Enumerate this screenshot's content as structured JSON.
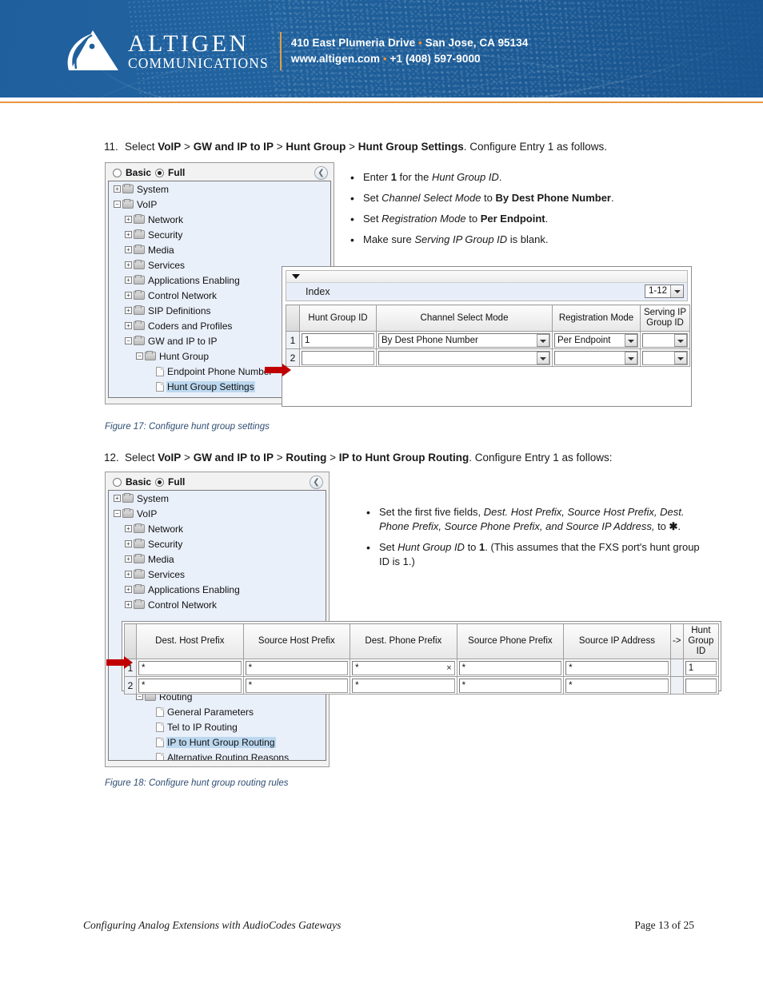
{
  "header": {
    "logo_primary": "ALTIGEN",
    "logo_secondary": "COMMUNICATIONS",
    "address_line1": "410 East Plumeria Drive",
    "address_line2_city": "San Jose, CA 95134",
    "website": "www.altigen.com",
    "phone": "+1 (408) 597-9000",
    "bullet": "•",
    "brand_blue": "#1f6097",
    "accent_orange": "#e8963c"
  },
  "steps": {
    "step11": {
      "number": "11.",
      "pre": "Select ",
      "path1": "VoIP",
      "sep": " > ",
      "path2": "GW and IP to IP",
      "path3": "Hunt Group",
      "path4": "Hunt Group Settings",
      "post": ".  Configure Entry 1 as follows."
    },
    "step12": {
      "number": "12.",
      "pre": "Select ",
      "path1": "VoIP",
      "sep": " > ",
      "path2": "GW and IP to IP",
      "path3": "Routing",
      "path4": "IP to Hunt Group Routing",
      "post": ". Configure Entry 1 as follows:"
    }
  },
  "bullets1": [
    {
      "parts": [
        {
          "t": "Enter ",
          "s": "n"
        },
        {
          "t": "1",
          "s": "b"
        },
        {
          "t": " for the ",
          "s": "n"
        },
        {
          "t": "Hunt Group ID",
          "s": "i"
        },
        {
          "t": ".",
          "s": "n"
        }
      ]
    },
    {
      "parts": [
        {
          "t": "Set ",
          "s": "n"
        },
        {
          "t": "Channel Select Mode",
          "s": "i"
        },
        {
          "t": " to ",
          "s": "n"
        },
        {
          "t": "By Dest Phone Number",
          "s": "b"
        },
        {
          "t": ".",
          "s": "n"
        }
      ]
    },
    {
      "parts": [
        {
          "t": "Set ",
          "s": "n"
        },
        {
          "t": "Registration Mode",
          "s": "i"
        },
        {
          "t": " to ",
          "s": "n"
        },
        {
          "t": "Per Endpoint",
          "s": "b"
        },
        {
          "t": ".",
          "s": "n"
        }
      ]
    },
    {
      "parts": [
        {
          "t": "Make sure ",
          "s": "n"
        },
        {
          "t": "Serving IP Group ID",
          "s": "i"
        },
        {
          "t": " is blank.",
          "s": "n"
        }
      ]
    }
  ],
  "bullets2": [
    {
      "parts": [
        {
          "t": "Set the first five fields, ",
          "s": "n"
        },
        {
          "t": "Dest. Host Prefix, Source Host Prefix, Dest. Phone Prefix, Source Phone Prefix, and Source IP Address,",
          "s": "i"
        },
        {
          "t": " to ",
          "s": "n"
        },
        {
          "t": "✱",
          "s": "b"
        },
        {
          "t": ".",
          "s": "n"
        }
      ]
    },
    {
      "parts": [
        {
          "t": "Set ",
          "s": "n"
        },
        {
          "t": "Hunt Group ID",
          "s": "i"
        },
        {
          "t": " to ",
          "s": "n"
        },
        {
          "t": "1",
          "s": "b"
        },
        {
          "t": ". (This assumes that the FXS port's hunt group ID is 1.)",
          "s": "n"
        }
      ]
    }
  ],
  "captions": {
    "figure17": "Figure 17: Configure hunt group settings",
    "figure18": "Figure 18: Configure hunt group routing rules"
  },
  "tree_header": {
    "basic_label": "Basic",
    "full_label": "Full",
    "selected": "Full",
    "collapse_glyph": "❮"
  },
  "tree1": [
    {
      "label": "System",
      "indent": 0,
      "type": "folder",
      "toggle": "+",
      "selected": false
    },
    {
      "label": "VoIP",
      "indent": 0,
      "type": "folder",
      "toggle": "−",
      "selected": false
    },
    {
      "label": "Network",
      "indent": 1,
      "type": "folder",
      "toggle": "+",
      "selected": false
    },
    {
      "label": "Security",
      "indent": 1,
      "type": "folder",
      "toggle": "+",
      "selected": false
    },
    {
      "label": "Media",
      "indent": 1,
      "type": "folder",
      "toggle": "+",
      "selected": false
    },
    {
      "label": "Services",
      "indent": 1,
      "type": "folder",
      "toggle": "+",
      "selected": false
    },
    {
      "label": "Applications Enabling",
      "indent": 1,
      "type": "folder",
      "toggle": "+",
      "selected": false
    },
    {
      "label": "Control Network",
      "indent": 1,
      "type": "folder",
      "toggle": "+",
      "selected": false
    },
    {
      "label": "SIP Definitions",
      "indent": 1,
      "type": "folder",
      "toggle": "+",
      "selected": false
    },
    {
      "label": "Coders and Profiles",
      "indent": 1,
      "type": "folder",
      "toggle": "+",
      "selected": false
    },
    {
      "label": "GW and IP to IP",
      "indent": 1,
      "type": "folder",
      "toggle": "−",
      "selected": false
    },
    {
      "label": "Hunt Group",
      "indent": 2,
      "type": "folder",
      "toggle": "−",
      "selected": false
    },
    {
      "label": "Endpoint Phone Number",
      "indent": 3,
      "type": "doc",
      "toggle": "",
      "selected": false
    },
    {
      "label": "Hunt Group Settings",
      "indent": 3,
      "type": "doc",
      "toggle": "",
      "selected": true
    }
  ],
  "tree2_top": [
    {
      "label": "System",
      "indent": 0,
      "type": "folder",
      "toggle": "+",
      "selected": false
    },
    {
      "label": "VoIP",
      "indent": 0,
      "type": "folder",
      "toggle": "−",
      "selected": false
    },
    {
      "label": "Network",
      "indent": 1,
      "type": "folder",
      "toggle": "+",
      "selected": false
    },
    {
      "label": "Security",
      "indent": 1,
      "type": "folder",
      "toggle": "+",
      "selected": false
    },
    {
      "label": "Media",
      "indent": 1,
      "type": "folder",
      "toggle": "+",
      "selected": false
    },
    {
      "label": "Services",
      "indent": 1,
      "type": "folder",
      "toggle": "+",
      "selected": false
    },
    {
      "label": "Applications Enabling",
      "indent": 1,
      "type": "folder",
      "toggle": "+",
      "selected": false
    },
    {
      "label": "Control Network",
      "indent": 1,
      "type": "folder",
      "toggle": "+",
      "selected": false
    }
  ],
  "tree2_bottom": [
    {
      "label": "Routing",
      "indent": 2,
      "type": "folder",
      "toggle": "−",
      "selected": false
    },
    {
      "label": "General Parameters",
      "indent": 3,
      "type": "doc",
      "toggle": "",
      "selected": false
    },
    {
      "label": "Tel to IP Routing",
      "indent": 3,
      "type": "doc",
      "toggle": "",
      "selected": false
    },
    {
      "label": "IP to Hunt Group Routing",
      "indent": 3,
      "type": "doc",
      "toggle": "",
      "selected": true
    },
    {
      "label": "Alternative Routing Reasons",
      "indent": 3,
      "type": "doc",
      "toggle": "",
      "selected": false
    }
  ],
  "hunt_group_table": {
    "index_label": "Index",
    "index_value": "1-12",
    "columns": [
      "Hunt\nGroup ID",
      "Channel Select Mode",
      "Registration\nMode",
      "Serving\nIP Group\nID"
    ],
    "col_hunt_group_id": "Hunt Group ID",
    "col_channel_select_mode": "Channel Select Mode",
    "col_registration_mode": "Registration Mode",
    "col_serving_ip_group_id": "Serving IP Group ID",
    "rows": [
      {
        "index": "1",
        "hunt_group_id": "1",
        "channel_select_mode": "By Dest Phone Number",
        "registration_mode": "Per Endpoint",
        "serving_ip_group_id": ""
      },
      {
        "index": "2",
        "hunt_group_id": "",
        "channel_select_mode": "",
        "registration_mode": "",
        "serving_ip_group_id": ""
      }
    ]
  },
  "routing_table": {
    "columns": [
      "Dest. Host Prefix",
      "Source Host Prefix",
      "Dest. Phone Prefix",
      "Source Phone Prefix",
      "Source IP Address"
    ],
    "arrow_col": "->",
    "hunt_col": "Hunt\nGroup\nID",
    "hunt_col_l1": "Hunt",
    "hunt_col_l2": "Group",
    "hunt_col_l3": "ID",
    "rows": [
      {
        "index": "1",
        "dest_host_prefix": "*",
        "source_host_prefix": "*",
        "dest_phone_prefix": "*",
        "dest_phone_prefix_x": "×",
        "source_phone_prefix": "*",
        "source_ip_address": "*",
        "hunt_group_id": "1"
      },
      {
        "index": "2",
        "dest_host_prefix": "*",
        "source_host_prefix": "*",
        "dest_phone_prefix": "*",
        "dest_phone_prefix_x": "",
        "source_phone_prefix": "*",
        "source_ip_address": "*",
        "hunt_group_id": ""
      }
    ]
  },
  "footer": {
    "doc_title": "Configuring Analog Extensions with AudioCodes Gateways",
    "page": "Page 13 of 25"
  }
}
